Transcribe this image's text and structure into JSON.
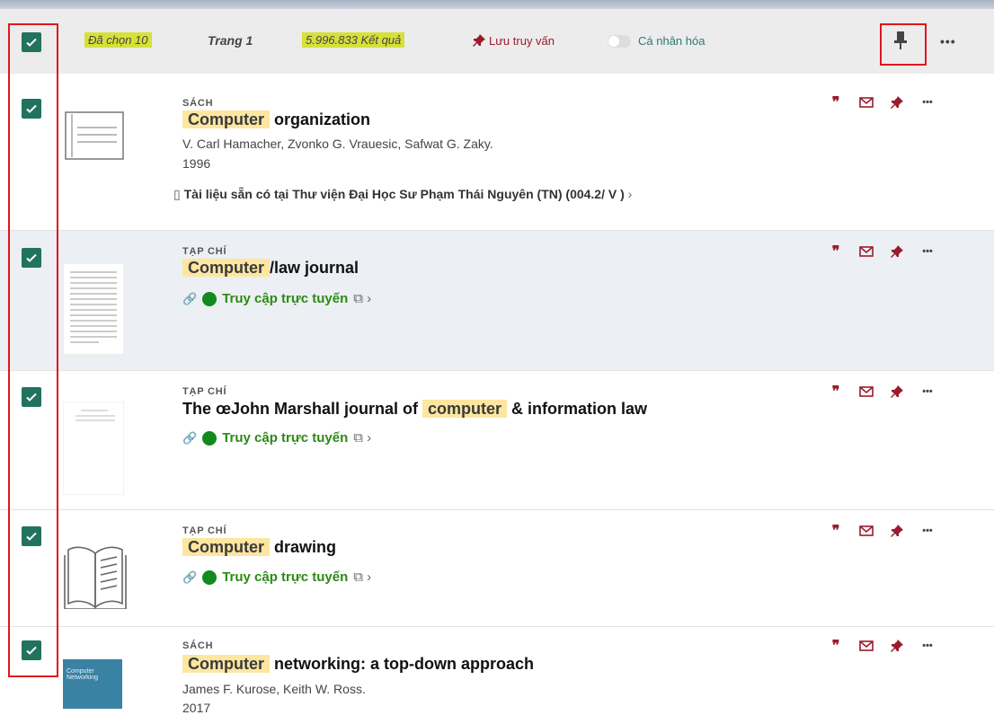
{
  "toolbar": {
    "selected": "Đã chọn 10",
    "page": "Trang 1",
    "results": "5.996.833 Kết quả",
    "save_query": "Lưu truy vấn",
    "personalize": "Cá nhân hóa"
  },
  "records": [
    {
      "type": "SÁCH",
      "title_highlight": "Computer",
      "title_rest": " organization",
      "authors": "V. Carl Hamacher, Zvonko G. Vrauesic, Safwat G. Zaky.",
      "year": "1996",
      "availability": "Tài liệu sẵn có tại Thư viện Đại Học Sư Phạm Thái Nguyên  (TN) (004.2/ V )"
    },
    {
      "type": "TẠP CHÍ",
      "title_highlight": "Computer",
      "title_rest": "/law journal",
      "online": "Truy cập trực tuyến"
    },
    {
      "type": "TẠP CHÍ",
      "title_prefix": "The œJohn Marshall journal of ",
      "title_highlight": "computer",
      "title_rest": " & information law",
      "online": "Truy cập trực tuyến"
    },
    {
      "type": "TẠP CHÍ",
      "title_highlight": "Computer",
      "title_rest": " drawing",
      "online": "Truy cập trực tuyến"
    },
    {
      "type": "SÁCH",
      "title_highlight": "Computer",
      "title_rest": " networking: a top-down approach",
      "authors": "James F. Kurose, Keith W. Ross.",
      "year": "2017",
      "thumb_text": "Computer Networking"
    }
  ],
  "icons": {
    "check": "check-icon",
    "quote": "quote-icon",
    "email": "email-icon",
    "pin": "pin-icon",
    "more": "more-icon"
  },
  "colors": {
    "accent": "#9a1b2e",
    "checkbox": "#21735f",
    "online": "#2b8a14",
    "highlight": "#fde6a0",
    "annotation": "#e0161b"
  }
}
